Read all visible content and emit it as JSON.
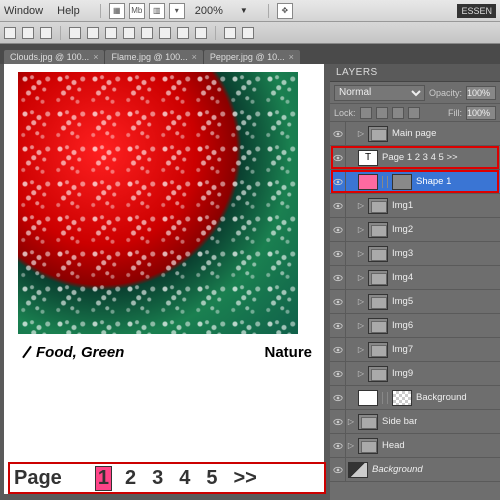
{
  "menu": {
    "window": "Window",
    "help": "Help",
    "zoom": "200%",
    "essen": "ESSEN"
  },
  "tabs": [
    {
      "label": "Clouds.jpg @ 100..."
    },
    {
      "label": "Flame.jpg @ 100..."
    },
    {
      "label": "Pepper.jpg @ 10..."
    }
  ],
  "caption": {
    "left": "Food, Green",
    "right": "Nature"
  },
  "pager": {
    "label": "Page",
    "pages": [
      "1",
      "2",
      "3",
      "4",
      "5"
    ],
    "active": 0,
    "next": ">>"
  },
  "layers_panel": {
    "title": "LAYERS",
    "blend_mode": "Normal",
    "opacity_label": "Opacity:",
    "opacity": "100%",
    "lock_label": "Lock:",
    "fill_label": "Fill:",
    "fill": "100%"
  },
  "layers": [
    {
      "name": "Main page",
      "type": "group"
    },
    {
      "name": "Page 1  2  3  4  5  >>",
      "type": "text",
      "redbox": true
    },
    {
      "name": "Shape 1",
      "type": "shape",
      "selected": true,
      "redbox": true
    },
    {
      "name": "Img1",
      "type": "group"
    },
    {
      "name": "Img2",
      "type": "group"
    },
    {
      "name": "Img3",
      "type": "group"
    },
    {
      "name": "Img4",
      "type": "group"
    },
    {
      "name": "Img5",
      "type": "group"
    },
    {
      "name": "Img6",
      "type": "group"
    },
    {
      "name": "Img7",
      "type": "group"
    },
    {
      "name": "Img9",
      "type": "group"
    },
    {
      "name": "Background",
      "type": "bg-masked"
    },
    {
      "name": "Side bar",
      "type": "group",
      "level": 0
    },
    {
      "name": "Head",
      "type": "group",
      "level": 0
    },
    {
      "name": "Background",
      "type": "bg",
      "italic": true,
      "level": 0
    }
  ]
}
